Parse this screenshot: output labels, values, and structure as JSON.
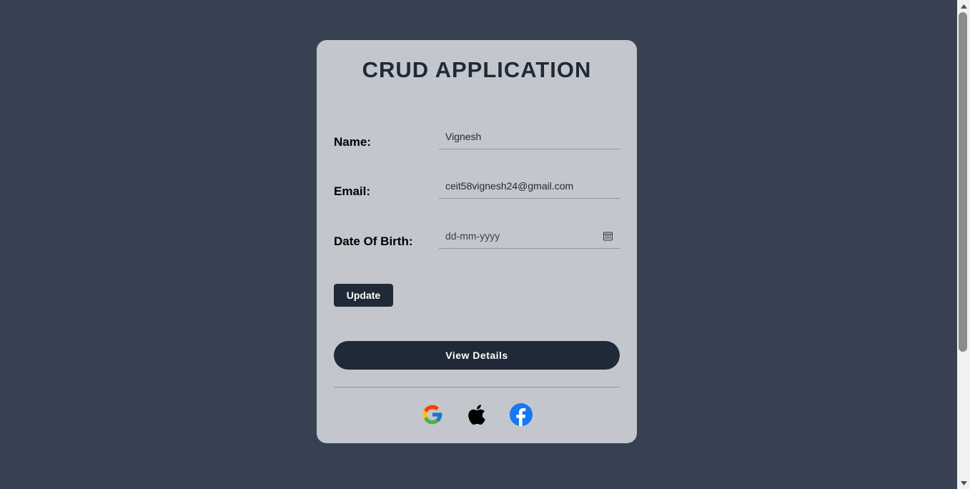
{
  "app": {
    "title": "CRUD APPLICATION"
  },
  "form": {
    "name_label": "Name:",
    "name_value": "Vignesh",
    "email_label": "Email:",
    "email_value": "ceit58vignesh24@gmail.com",
    "dob_label": "Date Of Birth:",
    "dob_placeholder": "dd-mm-yyyy",
    "dob_icon": "calendar-icon"
  },
  "actions": {
    "update_label": "Update",
    "view_details_label": "View Details"
  },
  "socials": [
    {
      "icon": "google-icon"
    },
    {
      "icon": "apple-icon"
    },
    {
      "icon": "facebook-icon"
    }
  ],
  "colors": {
    "background": "#374151",
    "card": "#c3c6cc",
    "primary": "#1f2937",
    "facebook": "#1877f2"
  }
}
